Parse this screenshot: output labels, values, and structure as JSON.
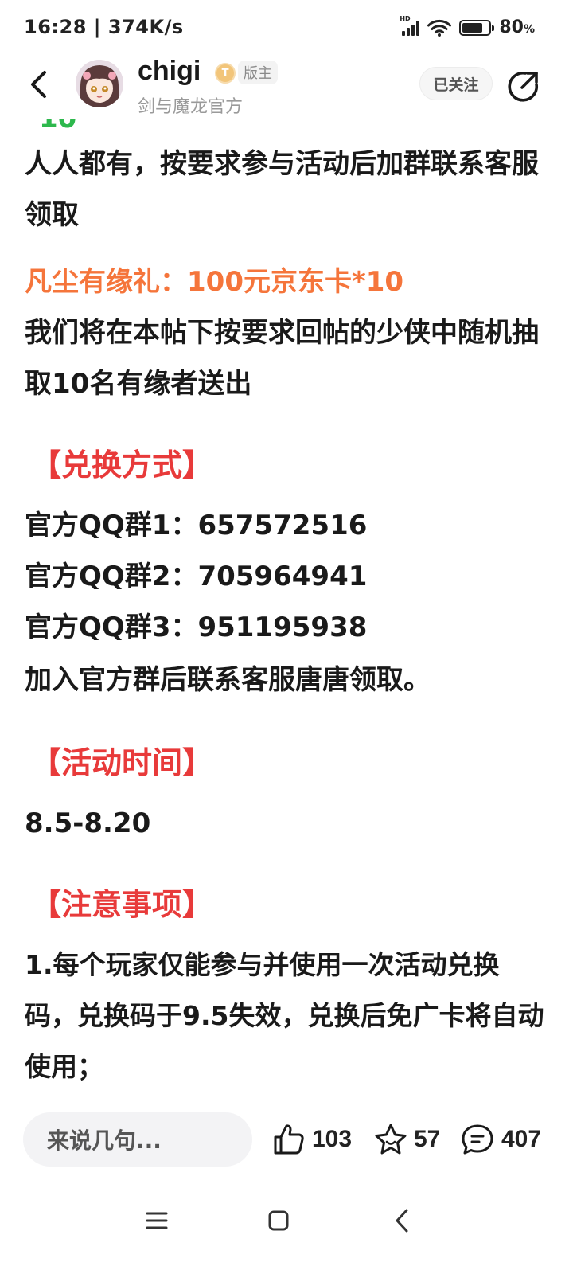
{
  "status_bar": {
    "time": "16:28",
    "net_speed": "374K/s",
    "signal_label": "HD",
    "battery_percent": "80",
    "battery_unit": "%",
    "battery_level": 0.8
  },
  "header": {
    "back_icon": "chevron-left-icon",
    "username": "chigi",
    "level_badge": "T",
    "role": "版主",
    "subtitle": "剑与魔龙官方",
    "follow_label": "已关注",
    "share_icon": "share-icon"
  },
  "post": {
    "partial_top": "10",
    "intro": "人人都有，按要求参与活动后加群联系客服领取",
    "lucky_title": "凡尘有缘礼：100元京东卡*10",
    "lucky_desc": "我们将在本帖下按要求回帖的少侠中随机抽取10名有缘者送出",
    "redeem_heading": "【兑换方式】",
    "qq_groups": [
      "官方QQ群1：657572516",
      "官方QQ群2：705964941",
      "官方QQ群3：951195938"
    ],
    "redeem_note": "加入官方群后联系客服唐唐领取。",
    "time_heading": "【活动时间】",
    "time_value": "8.5-8.20",
    "notes_heading": "【注意事项】",
    "note_1": "1.每个玩家仅能参与并使用一次活动兑换码，兑换码于9.5失效，兑换后免广卡将自动使用；"
  },
  "bottom_bar": {
    "comment_placeholder": "来说几句...",
    "like_count": "103",
    "favorite_count": "57",
    "comment_count": "407"
  },
  "nav_bar": {
    "menu_icon": "menu-icon",
    "home_icon": "home-square-icon",
    "back_icon": "back-triangle-icon"
  },
  "colors": {
    "orange": "#f5753b",
    "red": "#e83a3a",
    "green": "#2db84d"
  }
}
